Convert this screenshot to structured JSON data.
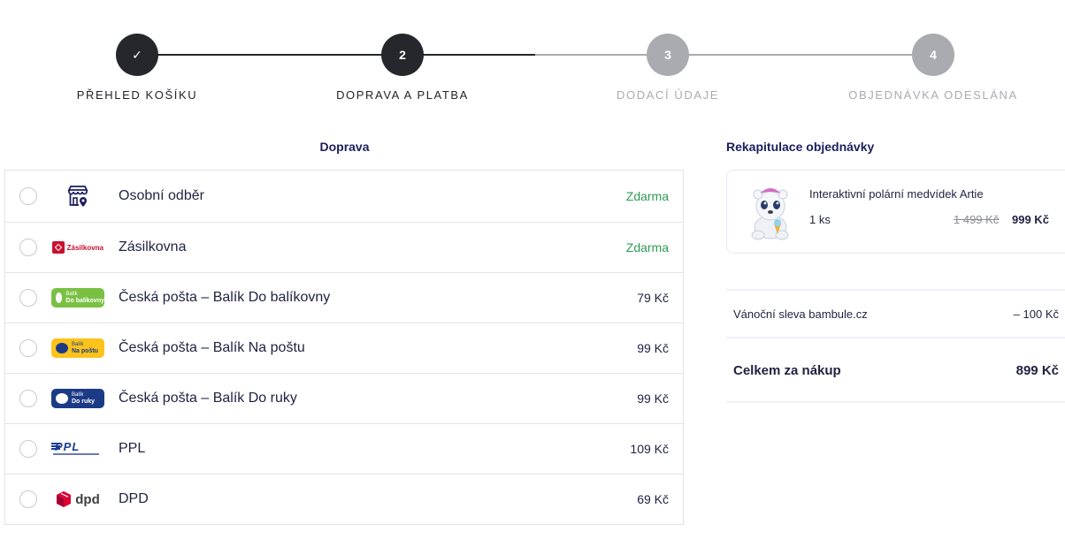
{
  "steps": [
    {
      "number": "✓",
      "label": "PŘEHLED KOŠÍKU",
      "state": "done"
    },
    {
      "number": "2",
      "label": "DOPRAVA A PLATBA",
      "state": "current"
    },
    {
      "number": "3",
      "label": "DODACÍ ÚDAJE",
      "state": "upcoming"
    },
    {
      "number": "4",
      "label": "OBJEDNÁVKA ODESLÁNA",
      "state": "upcoming"
    }
  ],
  "shipping": {
    "title": "Doprava",
    "options": [
      {
        "name": "Osobní odběr",
        "price": "Zdarma",
        "icon": "store-pin-icon",
        "selected": false
      },
      {
        "name": "Zásilkovna",
        "price": "Zdarma",
        "icon": "zasilkovna-logo",
        "logo_text": "Zásilkovna",
        "selected": false
      },
      {
        "name": "Česká pošta – Balík Do balíkovny",
        "price": "79 Kč",
        "icon": "balik-do-balikovny-logo",
        "logo_small": "Balík",
        "logo_big": "Do balíkovny",
        "selected": false
      },
      {
        "name": "Česká pošta – Balík Na poštu",
        "price": "99 Kč",
        "icon": "balik-na-postu-logo",
        "logo_small": "Balík",
        "logo_big": "Na poštu",
        "selected": false
      },
      {
        "name": "Česká pošta – Balík Do ruky",
        "price": "99 Kč",
        "icon": "balik-do-ruky-logo",
        "logo_small": "Balík",
        "logo_big": "Do ruky",
        "selected": false
      },
      {
        "name": "PPL",
        "price": "109 Kč",
        "icon": "ppl-logo",
        "logo_text": "PPL",
        "selected": false
      },
      {
        "name": "DPD",
        "price": "69 Kč",
        "icon": "dpd-logo",
        "logo_text": "dpd",
        "selected": false
      }
    ]
  },
  "recap": {
    "title": "Rekapitulace objednávky",
    "product": {
      "name": "Interaktivní polární medvídek Artie",
      "qty": "1 ks",
      "price_old": "1 499 Kč",
      "price_new": "999 Kč",
      "image": "polar-bear-toy-image"
    },
    "discount": {
      "label": "Vánoční sleva bambule.cz",
      "value": "– 100 Kč"
    },
    "total": {
      "label": "Celkem za nákup",
      "value": "899 Kč"
    }
  },
  "colors": {
    "step_dark": "#25272c",
    "step_grey": "#a9abb1",
    "title_navy": "#1b1f5e",
    "free_green": "#2f9a55",
    "zasilkovna_red": "#c8102e",
    "balikovna_green": "#7ac143",
    "posta_yellow": "#fcc31c",
    "posta_blue": "#1b3b87",
    "ppl_blue": "#1c3d93",
    "dpd_red": "#dc0032"
  }
}
